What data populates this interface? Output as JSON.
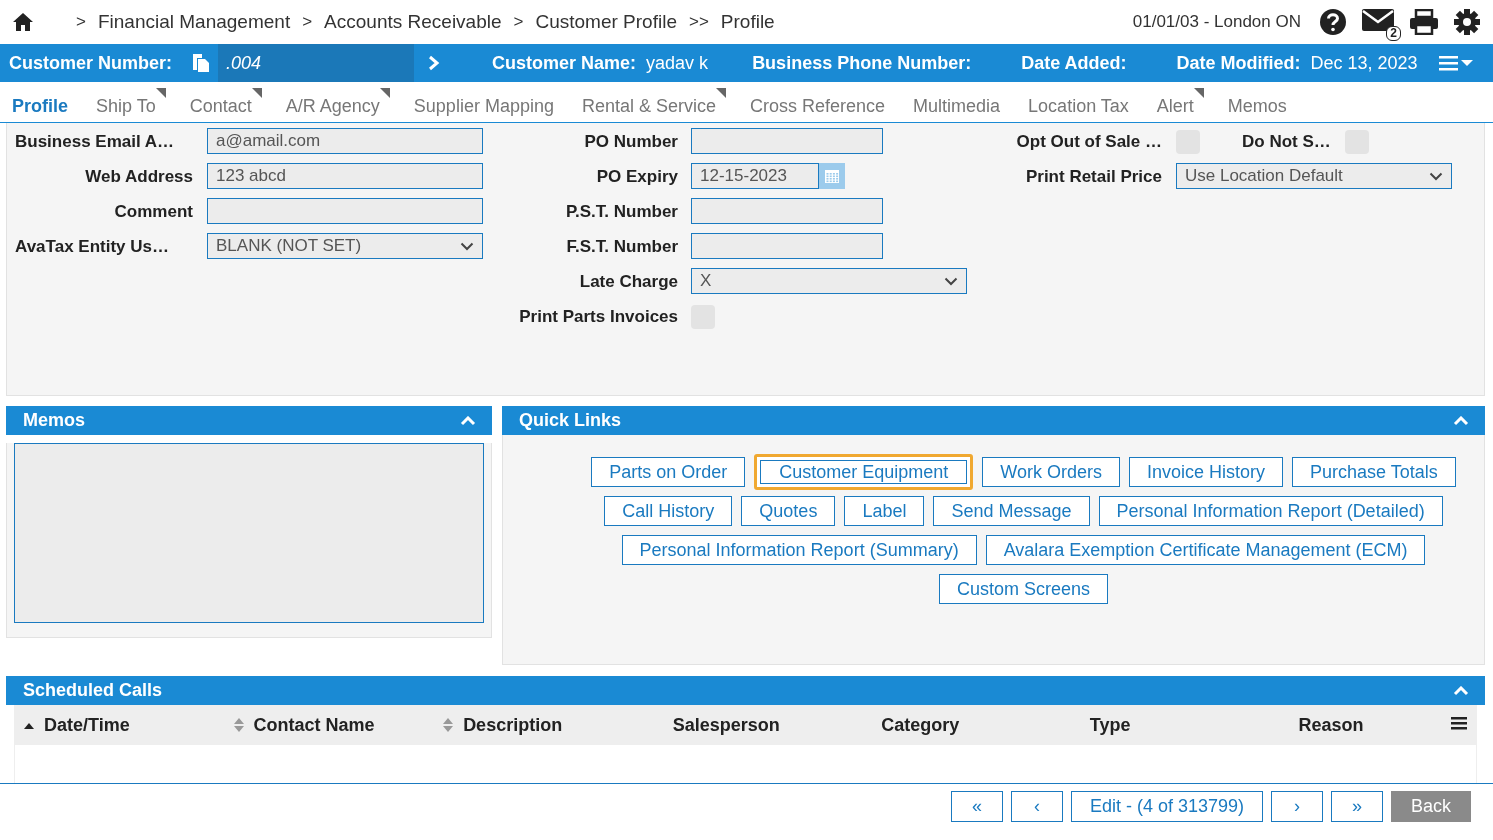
{
  "breadcrumb": [
    {
      "label": "Financial Management",
      "sep": ">"
    },
    {
      "label": "Accounts Receivable",
      "sep": ">"
    },
    {
      "label": "Customer Profile",
      "sep": ">"
    },
    {
      "label": "Profile",
      "sep": ">>"
    }
  ],
  "location": "01/01/03 - London ON",
  "message_count": "2",
  "header": {
    "customer_number_label": "Customer Number:",
    "customer_number": ".004",
    "customer_name_label": "Customer Name:",
    "customer_name": "yadav k",
    "phone_label": "Business Phone Number:",
    "date_added_label": "Date Added:",
    "date_modified_label": "Date Modified:",
    "date_modified": "Dec 13, 2023"
  },
  "tabs": [
    {
      "label": "Profile",
      "selected": true,
      "corner_mark": false
    },
    {
      "label": "Ship To",
      "selected": false,
      "corner_mark": true
    },
    {
      "label": "Contact",
      "selected": false,
      "corner_mark": true
    },
    {
      "label": "A/R Agency",
      "selected": false,
      "corner_mark": true
    },
    {
      "label": "Supplier Mapping",
      "selected": false,
      "corner_mark": false
    },
    {
      "label": "Rental & Service",
      "selected": false,
      "corner_mark": true
    },
    {
      "label": "Cross Reference",
      "selected": false,
      "corner_mark": false
    },
    {
      "label": "Multimedia",
      "selected": false,
      "corner_mark": false
    },
    {
      "label": "Location Tax",
      "selected": false,
      "corner_mark": false
    },
    {
      "label": "Alert",
      "selected": false,
      "corner_mark": true
    },
    {
      "label": "Memos",
      "selected": false,
      "corner_mark": false
    }
  ],
  "form_left": [
    {
      "label": "Business Email A…",
      "kind": "text",
      "value": "a@amail.com"
    },
    {
      "label": "Web Address",
      "kind": "text",
      "value": "123 abcd"
    },
    {
      "label": "Comment",
      "kind": "text"
    },
    {
      "label": "AvaTax Entity Us…",
      "kind": "select",
      "value": "BLANK (NOT SET)"
    }
  ],
  "form_middle": [
    {
      "label": "PO Number",
      "kind": "text"
    },
    {
      "label": "PO Expiry",
      "kind": "date",
      "value": "12-15-2023"
    },
    {
      "label": "P.S.T. Number",
      "kind": "text"
    },
    {
      "label": "F.S.T. Number",
      "kind": "text"
    },
    {
      "label": "Late Charge",
      "kind": "select",
      "value": "X"
    },
    {
      "label": "Print Parts Invoices",
      "kind": "checkbox",
      "checked": false
    }
  ],
  "form_right": {
    "checkboxes": [
      {
        "label": "Opt Out of Sale …",
        "checked": false
      },
      {
        "label": "Do Not S…",
        "checked": false
      }
    ],
    "print_retail_price": {
      "label": "Print Retail Price",
      "value": "Use Location Default"
    }
  },
  "memos": {
    "title": "Memos"
  },
  "quick_links": {
    "title": "Quick Links",
    "links": [
      {
        "label": "Parts on Order",
        "focused": false
      },
      {
        "label": "Customer Equipment",
        "focused": true
      },
      {
        "label": "Work Orders",
        "focused": false
      },
      {
        "label": "Invoice History",
        "focused": false
      },
      {
        "label": "Purchase Totals",
        "focused": false
      },
      {
        "label": "Call History",
        "focused": false
      },
      {
        "label": "Quotes",
        "focused": false
      },
      {
        "label": "Label",
        "focused": false
      },
      {
        "label": "Send Message",
        "focused": false
      },
      {
        "label": "Personal Information Report (Detailed)",
        "focused": false
      },
      {
        "label": "Personal Information Report (Summary)",
        "focused": false
      },
      {
        "label": "Avalara Exemption Certificate Management (ECM)",
        "focused": false
      },
      {
        "label": "Custom Screens",
        "focused": false
      }
    ]
  },
  "scheduled_calls": {
    "title": "Scheduled Calls",
    "columns": [
      {
        "label": "Date/Time",
        "sorted_ascending": true
      },
      {
        "label": "Contact Name",
        "sortable": true
      },
      {
        "label": "Description",
        "sortable": true
      },
      {
        "label": "Salesperson"
      },
      {
        "label": "Category"
      },
      {
        "label": "Type"
      },
      {
        "label": "Reason"
      }
    ]
  },
  "pager": {
    "first": "«",
    "prev": "‹",
    "status": "Edit - (4 of 313799)",
    "next": "›",
    "last": "»",
    "back": "Back"
  }
}
